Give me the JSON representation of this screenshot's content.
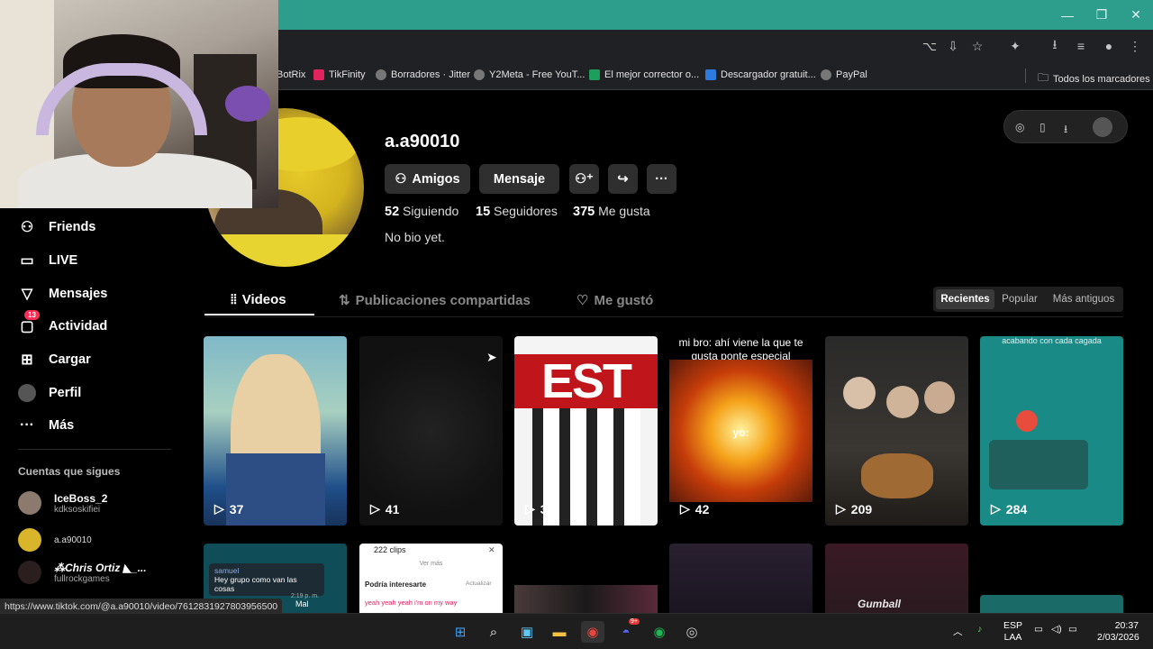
{
  "window": {
    "minimize": "—",
    "maximize": "❐",
    "close": "✕"
  },
  "bookmarks": [
    {
      "label": "BotRix",
      "color": "#8a8a8a"
    },
    {
      "label": "TikFinity",
      "color": "#e0245e"
    },
    {
      "label": "Borradores · Jitter",
      "color": "#777"
    },
    {
      "label": "Y2Meta - Free YouT...",
      "color": "#777"
    },
    {
      "label": "El mejor corrector o...",
      "color": "#1e9e5c"
    },
    {
      "label": "Descargador gratuit...",
      "color": "#2e7be0"
    },
    {
      "label": "PayPal",
      "color": "#777"
    }
  ],
  "bookmarks_all": "Todos los marcadores",
  "sidebar": {
    "items": [
      {
        "label": "Friends",
        "icon": "friends-icon"
      },
      {
        "label": "LIVE",
        "icon": "live-icon"
      },
      {
        "label": "Mensajes",
        "icon": "messages-icon"
      },
      {
        "label": "Actividad",
        "icon": "activity-icon",
        "badge": "13"
      },
      {
        "label": "Cargar",
        "icon": "upload-icon"
      },
      {
        "label": "Perfil",
        "icon": "profile-icon"
      },
      {
        "label": "Más",
        "icon": "more-icon"
      }
    ],
    "following_title": "Cuentas que sigues",
    "following": [
      {
        "name": "IceBoss_2",
        "handle": "kdksoskifiei"
      },
      {
        "name": "",
        "handle": "a.a90010"
      },
      {
        "name": "⁂Chris Ortiz ◣_...",
        "handle": "fullrockgames"
      }
    ]
  },
  "profile": {
    "username": "a.a90010",
    "friends_btn": "Amigos",
    "message_btn": "Mensaje",
    "more_btn": "···",
    "following_count": "52",
    "following_label": "Siguiendo",
    "followers_count": "15",
    "followers_label": "Seguidores",
    "likes_count": "375",
    "likes_label": "Me gusta",
    "bio": "No bio yet."
  },
  "tabs": [
    {
      "label": "Videos",
      "active": true
    },
    {
      "label": "Publicaciones compartidas",
      "active": false
    },
    {
      "label": "Me gustó",
      "active": false
    }
  ],
  "sort": [
    "Recientes",
    "Popular",
    "Más antiguos"
  ],
  "videos": [
    {
      "plays": "37",
      "caption": ""
    },
    {
      "plays": "41",
      "caption": ""
    },
    {
      "plays": "39",
      "caption": "EST"
    },
    {
      "plays": "42",
      "caption": "mi bro: ahí viene la que te gusta ponte especial",
      "overlay": "yo:"
    },
    {
      "plays": "209",
      "caption": ""
    },
    {
      "plays": "284",
      "caption": "acabando con cada cagada"
    }
  ],
  "row2": {
    "chat_name": "samuel",
    "chat_msg": "Hey grupo como van las cosas",
    "chat_time": "2:19 p. m.",
    "chat_mini": "Mal",
    "clips_title": "222 clips",
    "clips_more": "Ver más",
    "clips_label": "Podría interesarte",
    "clips_refresh": "Actualizar",
    "clips_song": "yeah yeah yeah i'm on my way",
    "cumball": "Gumball"
  },
  "status_url": "https://www.tiktok.com/@a.a90010/video/7612831927803956500",
  "tray": {
    "lang1": "ESP",
    "lang2": "LAA",
    "time": "20:37",
    "date": "2/03/2026",
    "discord_badge": "9+"
  }
}
